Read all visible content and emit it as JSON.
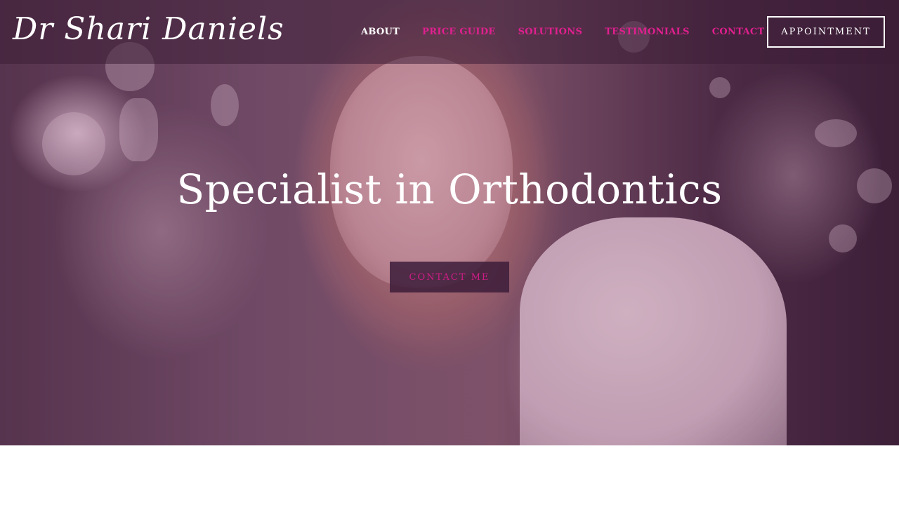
{
  "brand": {
    "logo_text": "Dr Shari Daniels"
  },
  "nav": {
    "items": [
      {
        "label": "ABOUT",
        "active": true
      },
      {
        "label": "PRICE GUIDE",
        "active": false
      },
      {
        "label": "SOLUTIONS",
        "active": false
      },
      {
        "label": "TESTIMONIALS",
        "active": false
      },
      {
        "label": "CONTACT",
        "active": false
      }
    ],
    "appointment_label": "APPOINTMENT"
  },
  "hero": {
    "headline": "Specialist in Orthodontics",
    "cta_label": "CONTACT ME",
    "image_description_icon": "hero-photo-smiling-woman"
  },
  "colors": {
    "accent_pink": "#e0208f",
    "nav_active": "#ffffff",
    "overlay": "#3c1e37"
  }
}
